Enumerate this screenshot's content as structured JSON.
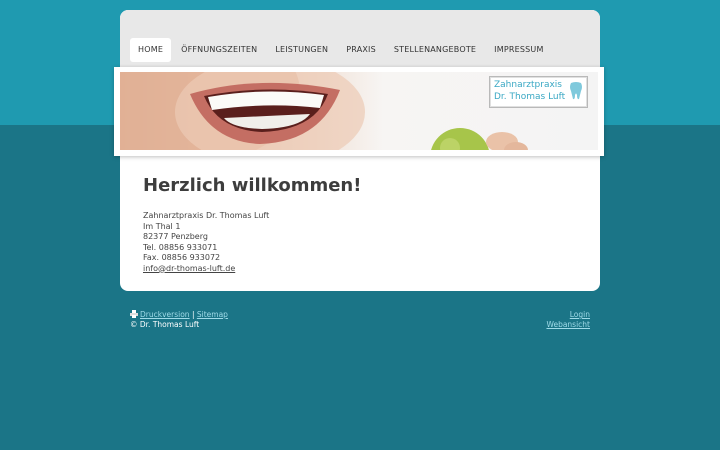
{
  "nav": {
    "items": [
      {
        "label": "HOME"
      },
      {
        "label": "ÖFFNUNGSZEITEN"
      },
      {
        "label": "LEISTUNGEN"
      },
      {
        "label": "PRAXIS"
      },
      {
        "label": "STELLENANGEBOTE"
      },
      {
        "label": "IMPRESSUM"
      }
    ],
    "active": "HOME"
  },
  "logo": {
    "line1": "Zahnarztpraxis",
    "line2": "Dr. Thomas Luft"
  },
  "main": {
    "title": "Herzlich willkommen!",
    "address": {
      "line1": "Zahnarztpraxis Dr. Thomas Luft",
      "line2": "Im Thal 1",
      "line3": "82377 Penzberg",
      "phone": "Tel.  08856 933071",
      "fax": "Fax. 08856 933072",
      "email": "info@dr-thomas-luft.de"
    }
  },
  "footer": {
    "print_label": "Druckversion",
    "separator": "|",
    "sitemap_label": "Sitemap",
    "copyright": "© Dr. Thomas Luft",
    "login_label": "Login",
    "webview_label": "Webansicht"
  },
  "colors": {
    "background_top": "#1f9ab0",
    "background_bottom": "#1b7587",
    "logo_accent": "#3aa8c4",
    "footer_link": "#9fdbe8"
  }
}
